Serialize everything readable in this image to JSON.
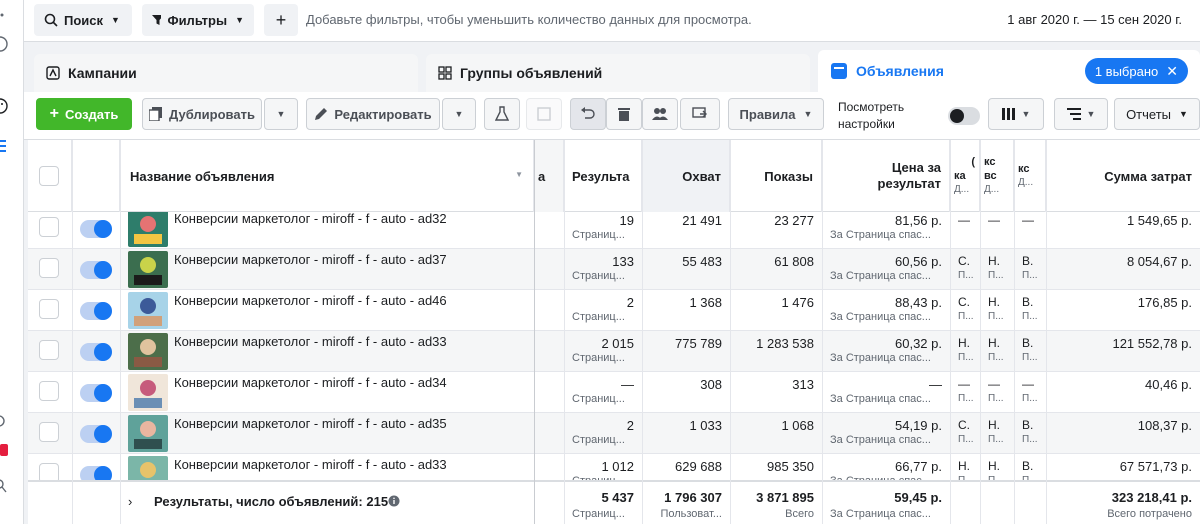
{
  "topbar": {
    "search_label": "Поиск",
    "filters_label": "Фильтры",
    "add_label": "+",
    "hint": "Добавьте фильтры, чтобы уменьшить количество данных для просмотра.",
    "date_range": "1 авг 2020 г. — 15 сен 2020 г."
  },
  "tabs": {
    "campaigns": "Кампании",
    "adsets": "Группы объявлений",
    "ads": "Объявления",
    "selected_badge": "1 выбрано",
    "close": "✕"
  },
  "toolbar": {
    "create": "Создать",
    "duplicate": "Дублировать",
    "edit": "Редактировать",
    "rules": "Правила",
    "view_settings_line1": "Посмотреть",
    "view_settings_line2": "настройки",
    "reports": "Отчеты",
    "view_settings_toggle": "off"
  },
  "columns": {
    "name": "Название объявления",
    "name_truncated": "а",
    "results": "Результа",
    "reach": "Охват",
    "impressions": "Показы",
    "cost_line1": "Цена за",
    "cost_line2": "результат",
    "c1_line1": "(",
    "c1_line2": "ка",
    "c1_line3": "Д...",
    "c2_line1": "кс",
    "c2_line2": "вс",
    "c2_line3": "Д...",
    "c3_line1": "кс",
    "c3_line2": "Д...",
    "spent": "Сумма затрат"
  },
  "rows": [
    {
      "name": "Конверсии маркетолог - miroff - f - auto - ad32",
      "results": "19",
      "results_sub": "Страниц...",
      "reach": "21 491",
      "impressions": "23 277",
      "cost": "81,56 р.",
      "cost_sub": "За Страница спас...",
      "c1": "—",
      "c1s": "",
      "c2": "—",
      "c2s": "",
      "c3": "—",
      "c3s": "",
      "spent": "1 549,65 р."
    },
    {
      "name": "Конверсии маркетолог - miroff - f - auto - ad37",
      "results": "133",
      "results_sub": "Страниц...",
      "reach": "55 483",
      "impressions": "61 808",
      "cost": "60,56 р.",
      "cost_sub": "За Страница спас...",
      "c1": "С.",
      "c1s": "П...",
      "c2": "Н.",
      "c2s": "П...",
      "c3": "В.",
      "c3s": "П...",
      "spent": "8 054,67 р."
    },
    {
      "name": "Конверсии маркетолог - miroff - f - auto - ad46",
      "results": "2",
      "results_sub": "Страниц...",
      "reach": "1 368",
      "impressions": "1 476",
      "cost": "88,43 р.",
      "cost_sub": "За Страница спас...",
      "c1": "С.",
      "c1s": "П...",
      "c2": "Н.",
      "c2s": "П...",
      "c3": "В.",
      "c3s": "П...",
      "spent": "176,85 р."
    },
    {
      "name": "Конверсии маркетолог - miroff - f - auto - ad33",
      "results": "2 015",
      "results_sub": "Страниц...",
      "reach": "775 789",
      "impressions": "1 283 538",
      "cost": "60,32 р.",
      "cost_sub": "За Страница спас...",
      "c1": "Н.",
      "c1s": "П...",
      "c2": "Н.",
      "c2s": "П...",
      "c3": "В.",
      "c3s": "П...",
      "spent": "121 552,78 р."
    },
    {
      "name": "Конверсии маркетолог - miroff - f - auto - ad34",
      "results": "—",
      "results_sub": "Страниц...",
      "reach": "308",
      "impressions": "313",
      "cost": "—",
      "cost_sub": "За Страница спас...",
      "c1": "—",
      "c1s": "П...",
      "c2": "—",
      "c2s": "П...",
      "c3": "—",
      "c3s": "П...",
      "spent": "40,46 р."
    },
    {
      "name": "Конверсии маркетолог - miroff - f - auto - ad35",
      "results": "2",
      "results_sub": "Страниц...",
      "reach": "1 033",
      "impressions": "1 068",
      "cost": "54,19 р.",
      "cost_sub": "За Страница спас...",
      "c1": "С.",
      "c1s": "П...",
      "c2": "Н.",
      "c2s": "П...",
      "c3": "В.",
      "c3s": "П...",
      "spent": "108,37 р."
    },
    {
      "name": "Конверсии маркетолог - miroff - f - auto - ad33",
      "results": "1 012",
      "results_sub": "Страниц...",
      "reach": "629 688",
      "impressions": "985 350",
      "cost": "66,77 р.",
      "cost_sub": "За Страница спас...",
      "c1": "Н.",
      "c1s": "П...",
      "c2": "Н.",
      "c2s": "П...",
      "c3": "В.",
      "c3s": "П...",
      "spent": "67 571,73 р."
    }
  ],
  "footer": {
    "label": "Результаты, число объявлений: 215",
    "results": "5 437",
    "results_sub": "Страниц...",
    "reach": "1 796 307",
    "reach_sub": "Пользоват...",
    "impressions": "3 871 895",
    "impressions_sub": "Всего",
    "cost": "59,45 р.",
    "cost_sub": "За Страница спас...",
    "spent": "323 218,41 р.",
    "spent_sub": "Всего потрачено"
  },
  "colors": {
    "accent": "#1877f2",
    "create": "#42b72a"
  }
}
